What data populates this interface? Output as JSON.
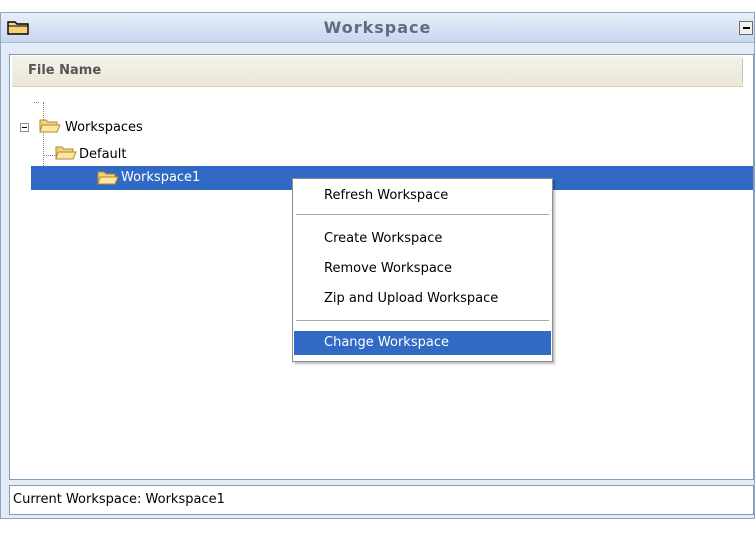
{
  "window": {
    "title": "Workspace",
    "icons": {
      "title": "folder-icon",
      "minimize": "minimize-icon"
    }
  },
  "tree": {
    "column_header": "File Name",
    "root": {
      "label": "Workspaces",
      "expanded": true
    },
    "children": [
      {
        "label": "Default",
        "selected": false
      },
      {
        "label": "Workspace1",
        "selected": true
      }
    ]
  },
  "context_menu": {
    "items": [
      {
        "label": "Refresh Workspace",
        "active": false
      },
      {
        "label": "Create Workspace",
        "active": false
      },
      {
        "label": "Remove Workspace",
        "active": false
      },
      {
        "label": "Zip and Upload Workspace",
        "active": false
      },
      {
        "label": "Change Workspace",
        "active": true
      }
    ]
  },
  "status": {
    "text": "Current Workspace: Workspace1"
  },
  "colors": {
    "selection": "#316ac5",
    "title_text": "#606b7d",
    "folder": "#f5d27a"
  }
}
